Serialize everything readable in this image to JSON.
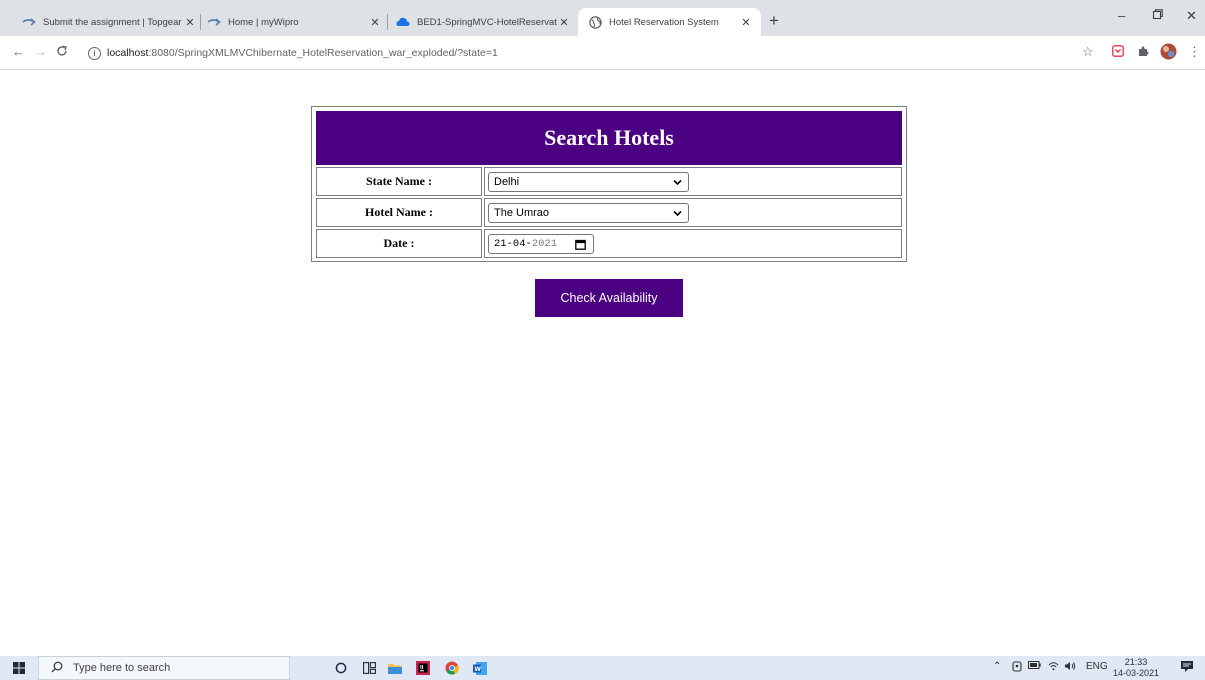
{
  "browser": {
    "tabs": [
      {
        "title": "Submit the assignment | Topgear",
        "active": false
      },
      {
        "title": "Home | myWipro",
        "active": false
      },
      {
        "title": "BED1-SpringMVC-HotelReservati",
        "active": false
      },
      {
        "title": "Hotel Reservation System",
        "active": true
      }
    ],
    "address": {
      "host": "localhost",
      "path": ":8080/SpringXMLMVChibernate_HotelReservation_war_exploded/?state=1"
    }
  },
  "page": {
    "header": "Search Hotels",
    "fields": {
      "state": {
        "label": "State Name :",
        "value": "Delhi"
      },
      "hotel": {
        "label": "Hotel Name :",
        "value": "The Umrao"
      },
      "date": {
        "label": "Date :",
        "value_dm": "21-04-",
        "value_year": "2021"
      }
    },
    "button_label": "Check Availability"
  },
  "taskbar": {
    "search_placeholder": "Type here to search",
    "language": "ENG",
    "time": "21:33",
    "date": "14-03-2021"
  },
  "colors": {
    "accent": "#4b0082",
    "tabstrip": "#dee1e6",
    "taskbar": "#dfe8f4"
  }
}
